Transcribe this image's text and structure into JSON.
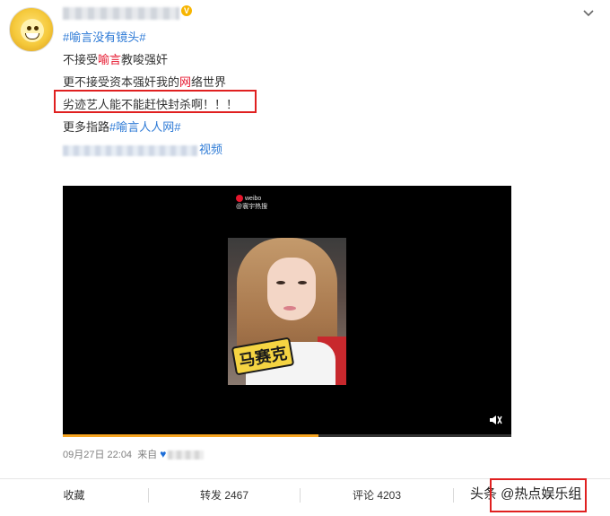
{
  "post": {
    "topic": "#喻言没有镜头#",
    "lines": [
      {
        "a": "不接受",
        "hl": "喻言",
        "b": "教唆强奸"
      },
      {
        "a": "更不接受资本强奸我的",
        "hl": "网",
        "b": "络世界"
      },
      {
        "a": "劣迹艺人能不能赶快封杀啊！！！"
      },
      {
        "a": "更多指路",
        "topic": "#喻言人人网#"
      }
    ],
    "video_link": "视频"
  },
  "video": {
    "logo_line1": "weibo",
    "logo_line2": "@寰宇热搜",
    "sticker": "马赛克",
    "progress_fraction": 0.57
  },
  "meta": {
    "time": "09月27日 22:04",
    "source_label": "来自"
  },
  "actions": {
    "favorite": "收藏",
    "repost": "转发 2467",
    "comment": "评论 4203"
  },
  "watermark": "头条 @热点娱乐组",
  "colors": {
    "topic": "#2d7ad6",
    "highlight": "#e6162d",
    "annotation": "#e02020"
  }
}
